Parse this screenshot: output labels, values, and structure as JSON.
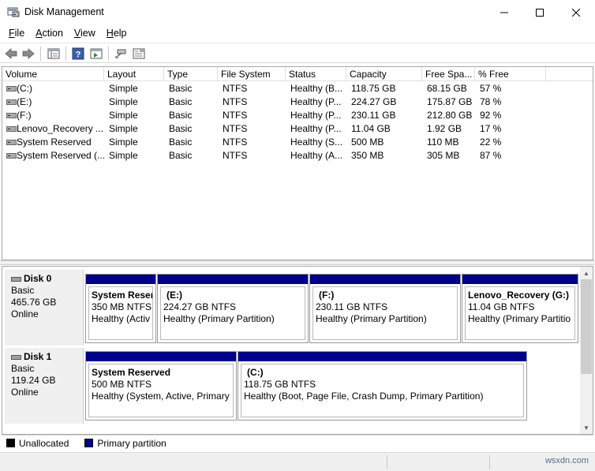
{
  "window": {
    "title": "Disk Management"
  },
  "menu": [
    {
      "label": "File",
      "key": "F",
      "rest": "ile"
    },
    {
      "label": "Action",
      "key": "A",
      "rest": "ction"
    },
    {
      "label": "View",
      "key": "V",
      "rest": "iew"
    },
    {
      "label": "Help",
      "key": "H",
      "rest": "elp"
    }
  ],
  "list": {
    "columns": [
      "Volume",
      "Layout",
      "Type",
      "File System",
      "Status",
      "Capacity",
      "Free Spa...",
      "% Free"
    ],
    "rows": [
      [
        "(C:)",
        "Simple",
        "Basic",
        "NTFS",
        "Healthy (B...",
        "118.75 GB",
        "68.15 GB",
        "57 %"
      ],
      [
        "(E:)",
        "Simple",
        "Basic",
        "NTFS",
        "Healthy (P...",
        "224.27 GB",
        "175.87 GB",
        "78 %"
      ],
      [
        "(F:)",
        "Simple",
        "Basic",
        "NTFS",
        "Healthy (P...",
        "230.11 GB",
        "212.80 GB",
        "92 %"
      ],
      [
        "Lenovo_Recovery ...",
        "Simple",
        "Basic",
        "NTFS",
        "Healthy (P...",
        "11.04 GB",
        "1.92 GB",
        "17 %"
      ],
      [
        "System Reserved",
        "Simple",
        "Basic",
        "NTFS",
        "Healthy (S...",
        "500 MB",
        "110 MB",
        "22 %"
      ],
      [
        "System Reserved (...",
        "Simple",
        "Basic",
        "NTFS",
        "Healthy (A...",
        "350 MB",
        "305 MB",
        "87 %"
      ]
    ]
  },
  "disks": [
    {
      "name": "Disk 0",
      "type": "Basic",
      "size": "465.76 GB",
      "state": "Online",
      "partitions": [
        {
          "name": "System Reser",
          "size": "350 MB NTFS",
          "status": "Healthy (Activ"
        },
        {
          "name": "(E:)",
          "size": "224.27 GB NTFS",
          "status": "Healthy (Primary Partition)"
        },
        {
          "name": "(F:)",
          "size": "230.11 GB NTFS",
          "status": "Healthy (Primary Partition)"
        },
        {
          "name": "Lenovo_Recovery  (G:)",
          "size": "11.04 GB NTFS",
          "status": "Healthy (Primary Partitio"
        }
      ]
    },
    {
      "name": "Disk 1",
      "type": "Basic",
      "size": "119.24 GB",
      "state": "Online",
      "partitions": [
        {
          "name": "System Reserved",
          "size": "500 MB NTFS",
          "status": "Healthy (System, Active, Primary I"
        },
        {
          "name": "(C:)",
          "size": "118.75 GB NTFS",
          "status": "Healthy (Boot, Page File, Crash Dump, Primary Partition)"
        }
      ]
    }
  ],
  "legend": [
    {
      "label": "Unallocated",
      "color": "#000000"
    },
    {
      "label": "Primary partition",
      "color": "#00008b"
    }
  ],
  "colors": {
    "primary_partition_bar": "#00008b",
    "unallocated": "#000000"
  },
  "watermark": "wsxdn.com"
}
